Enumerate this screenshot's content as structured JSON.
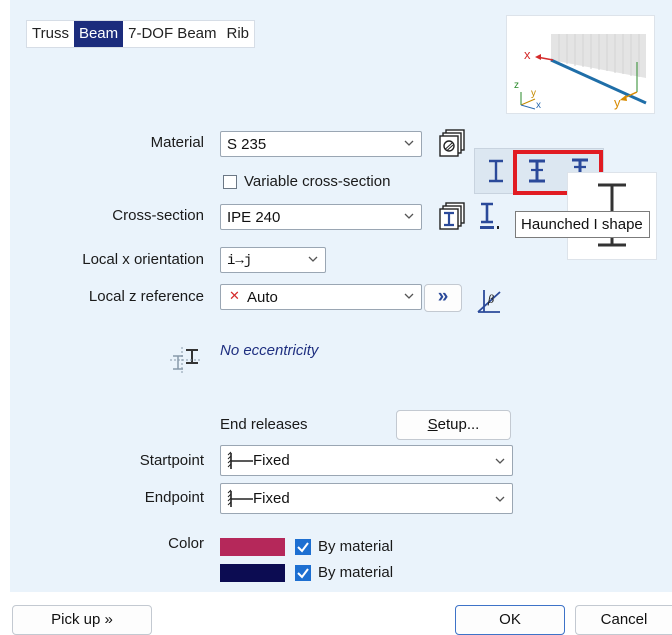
{
  "tabs": [
    {
      "label": "Truss",
      "active": false
    },
    {
      "label": "Beam",
      "active": true
    },
    {
      "label": "7-DOF Beam",
      "active": false
    },
    {
      "label": "Rib",
      "active": false
    }
  ],
  "axis_preview": {
    "x_label": "x",
    "y_label": "y",
    "mini_z": "z",
    "mini_y": "y",
    "mini_x": "x"
  },
  "material": {
    "label": "Material",
    "value": "S 235",
    "icon": "material-library-icon"
  },
  "variable_section": {
    "label": "Variable cross-section",
    "checked": false
  },
  "cross_section": {
    "label": "Cross-section",
    "value": "IPE 240",
    "icon": "section-library-icon"
  },
  "local_x": {
    "label": "Local x orientation",
    "value": "i→j"
  },
  "local_z": {
    "label": "Local z reference",
    "value": "Auto",
    "more": "»"
  },
  "eccentricity": {
    "text": "No eccentricity"
  },
  "end_releases": {
    "label": "End releases",
    "setup_button": "Setup...",
    "setup_underline": "S",
    "setup_rest": "etup..."
  },
  "startpoint": {
    "label": "Startpoint",
    "value": "Fixed"
  },
  "endpoint": {
    "label": "Endpoint",
    "value": "Fixed"
  },
  "color": {
    "label": "Color",
    "swatches": [
      {
        "color": "#b5285a",
        "label": "By material",
        "checked": true
      },
      {
        "color": "#0c0c52",
        "label": "By material",
        "checked": true
      }
    ]
  },
  "shape_toolbar": {
    "tooltip": "Haunched I shape",
    "highlight_color": "#e11b22"
  },
  "buttons": {
    "pickup": "Pick up »",
    "ok": "OK",
    "cancel": "Cancel"
  },
  "colors": {
    "accent": "#1c2c7c",
    "icon_blue": "#2b4a9a",
    "panel": "#eaf3fb"
  }
}
